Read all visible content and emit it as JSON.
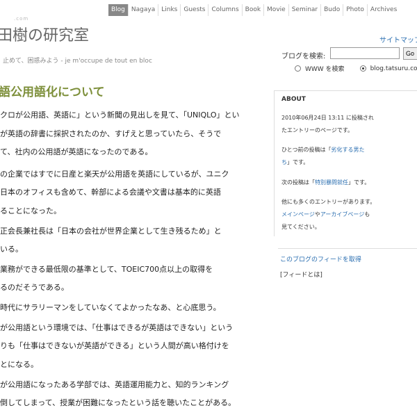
{
  "nav": [
    "Blog",
    "Nagaya",
    "Links",
    "Guests",
    "Columns",
    "Book",
    "Movie",
    "Seminar",
    "Budo",
    "Photo",
    "Archives"
  ],
  "site": {
    "small": ".com",
    "title": "田樹の研究室",
    "tagline": "止めて、困惑みよう - je m'occupe de tout en bloc"
  },
  "sidebar": {
    "sitemap": "サイトマップ",
    "search_label": "ブログを検索:",
    "search_button": "Go",
    "radio_www": "WWW を検索",
    "radio_blog": "blog.tatsuru.com",
    "about_title": "ABOUT",
    "about_1": "2010年06月24日 13:11 に投稿され",
    "about_2": "たエントリーのページです。",
    "prev_1_a": "ひとつ前の投稿は「",
    "prev_1_link": "劣化する男た",
    "prev_2_link": "ち",
    "prev_2_b": "」です。",
    "next_a": "次の投稿は「",
    "next_link": "特別暴問就任",
    "next_b": "」です。",
    "more_1": "他にも多くのエントリーがあります。",
    "more_2_link1": "メインページ",
    "more_2_mid": "や",
    "more_2_link2": "アーカイブページ",
    "more_2_b": "も",
    "more_3": "見てください。",
    "feed_link": "このブログのフィードを取得",
    "feed_about": "[フィードとは]"
  },
  "article": {
    "title": "語公用語化について",
    "lines": [
      "クロが公用語、英語に」という新聞の見出しを見て、「UNIQLO」とい",
      "が英語の辞書に採択されたのか、すげえと思っていたら、そうで",
      "て、社内の公用語が英語になったのである。",
      "の企業ではすでに日産と楽天が公用語を英語にしているが、ユニク",
      "日本のオフィスも含めて、幹部による会議や文書は基本的に英語",
      "ることになった。",
      "正会長兼社長は「日本の会社が世界企業として生き残るため」と",
      "いる。",
      "業務ができる最低限の基準として、TOEIC700点以上の取得を",
      "るのだそうである。",
      "時代にサラリーマンをしていなくてよかったなあ、と心底思う。",
      "が公用語という環境では、「仕事はできるが英語はできない」という",
      "りも「仕事はできないが英語ができる」という人間が高い格付けを",
      "とになる。",
      "が公用語になったある学部では、英語運用能力と、知的ランキング",
      "倒してしまって、授業が困難になったという話を聴いたことがある。"
    ]
  }
}
